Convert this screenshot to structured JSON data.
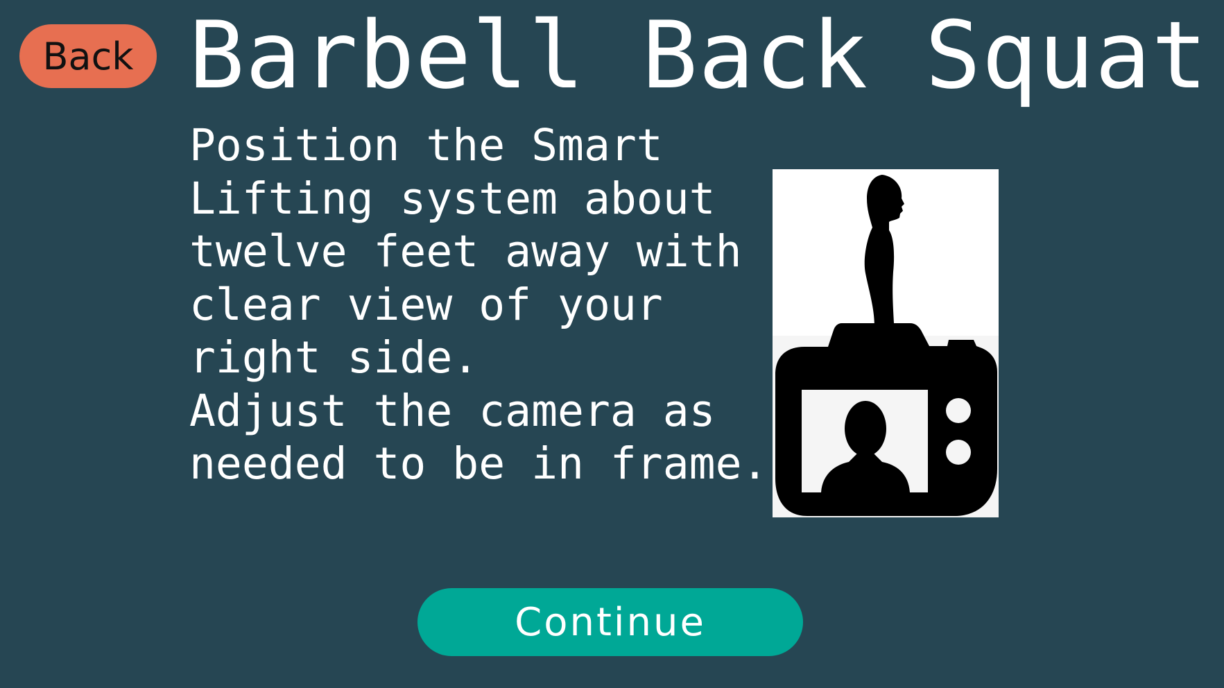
{
  "header": {
    "back_label": "Back",
    "title": "Barbell Back Squat"
  },
  "instructions": {
    "lines": [
      "Position the Smart",
      "Lifting system about",
      "twelve feet away with",
      "clear view of your",
      "right side.",
      "Adjust the camera as",
      "needed to be in frame."
    ]
  },
  "illustration": {
    "icons": [
      "standing-person-silhouette-icon",
      "camera-icon",
      "person-portrait-icon"
    ]
  },
  "footer": {
    "continue_label": "Continue"
  },
  "colors": {
    "background": "#264653",
    "back_button": "#e76f51",
    "continue_button": "#00a896",
    "text": "#ffffff"
  }
}
